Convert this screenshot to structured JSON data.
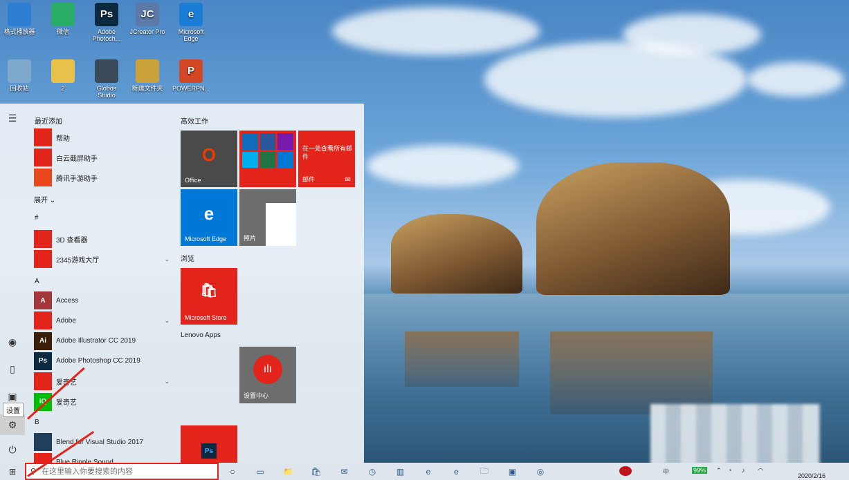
{
  "desktop": {
    "icons": [
      {
        "label": "格式播放器",
        "icon": "video-player-icon",
        "color": "#2d7fd3"
      },
      {
        "label": "微信",
        "icon": "wechat-icon",
        "color": "#2aae67"
      },
      {
        "label": "Adobe Photosh...",
        "icon": "photoshop-icon",
        "color": "#0b2940",
        "glyph": "Ps"
      },
      {
        "label": "JCreator Pro",
        "icon": "jcreator-icon",
        "color": "#5b7aa8",
        "glyph": "JC"
      },
      {
        "label": "Microsoft Edge",
        "icon": "edge-icon",
        "color": "#1b7cd6",
        "glyph": "e"
      },
      {
        "label": "回收站",
        "icon": "recycle-bin-icon",
        "color": "#7fa9cc"
      },
      {
        "label": "2",
        "icon": "folder-icon",
        "color": "#e8c14a"
      },
      {
        "label": "Globos Studio",
        "icon": "globos-icon",
        "color": "#3a4a5a"
      },
      {
        "label": "新建文件夹",
        "icon": "folder-zip-icon",
        "color": "#c9a23b"
      },
      {
        "label": "POWERPN...",
        "icon": "powerpoint-icon",
        "color": "#d24726",
        "glyph": "P"
      }
    ]
  },
  "start_menu": {
    "recent_header": "最近添加",
    "recent": [
      {
        "label": "帮助",
        "icon": "help-icon",
        "color": "#e2241b"
      },
      {
        "label": "白云截屏助手",
        "icon": "screenshot-icon",
        "color": "#e2241b"
      },
      {
        "label": "腾讯手游助手",
        "icon": "tencent-game-icon",
        "color": "#e8481b"
      }
    ],
    "expand_label": "展开 ⌄",
    "sections": [
      {
        "letter": "#",
        "apps": [
          {
            "label": "3D 查看器",
            "icon": "3d-viewer-icon",
            "color": "#e2241b"
          },
          {
            "label": "2345游戏大厅",
            "icon": "folder-icon",
            "color": "#e2241b",
            "chevron": true
          }
        ]
      },
      {
        "letter": "A",
        "apps": [
          {
            "label": "Access",
            "icon": "access-icon",
            "color": "#a4373a",
            "glyph": "A"
          },
          {
            "label": "Adobe",
            "icon": "folder-icon",
            "color": "#e2241b",
            "chevron": true
          },
          {
            "label": "Adobe Illustrator CC 2019",
            "icon": "illustrator-icon",
            "color": "#3a1e05",
            "glyph": "Ai"
          },
          {
            "label": "Adobe Photoshop CC 2019",
            "icon": "photoshop-icon",
            "color": "#0b2940",
            "glyph": "Ps"
          },
          {
            "label": "爱奇艺",
            "icon": "folder-icon",
            "color": "#e2241b",
            "chevron": true
          },
          {
            "label": "爱奇艺",
            "icon": "iqiyi-icon",
            "color": "#00be06",
            "glyph": "iQ"
          }
        ]
      },
      {
        "letter": "B",
        "apps": [
          {
            "label": "Blend for Visual Studio 2017",
            "icon": "blend-icon",
            "color": "#1f3f5a"
          },
          {
            "label": "Blue Ripple Sound",
            "icon": "folder-icon",
            "color": "#e2241b",
            "chevron": true
          }
        ]
      }
    ],
    "rail": {
      "menu": "☰",
      "user": "◉",
      "documents": "▯",
      "pictures": "▣",
      "settings": "⚙",
      "power": "⏻",
      "settings_tooltip": "设置"
    },
    "tile_groups": [
      {
        "title": "高效工作"
      },
      {
        "title": "浏览"
      },
      {
        "title": "Lenovo Apps"
      }
    ],
    "tiles": {
      "office": {
        "label": "Office",
        "glyph": "O"
      },
      "mail_title": "在一处查看所有邮件",
      "mail_label": "邮件",
      "edge": {
        "label": "Microsoft Edge",
        "glyph": "e"
      },
      "photos": {
        "label": "照片"
      },
      "store": {
        "label": "Microsoft Store",
        "glyph": "🛍"
      },
      "settings_center": {
        "label": "设置中心"
      },
      "photoshop": {
        "glyph": "Ps"
      }
    }
  },
  "taskbar": {
    "search_placeholder": "在这里输入你要搜索的内容",
    "start": "⊞",
    "task_view": "○",
    "items": [
      "▭",
      "📁",
      "🛍",
      "✉",
      "◷",
      "▥",
      "e",
      "e",
      "🗀",
      "▣",
      "◎"
    ],
    "tray": {
      "battery": "99%",
      "time": "2020/2/16"
    }
  }
}
